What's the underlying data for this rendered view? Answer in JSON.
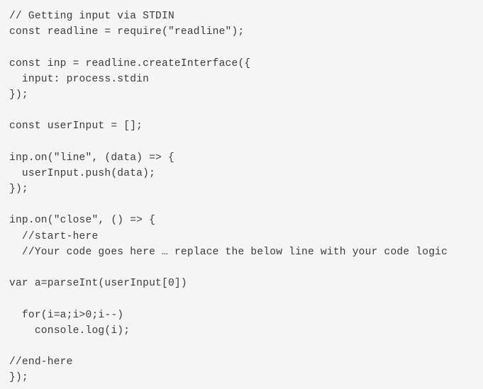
{
  "code_editor": {
    "lines": [
      "// Getting input via STDIN",
      "const readline = require(\"readline\");",
      "",
      "const inp = readline.createInterface({",
      "  input: process.stdin",
      "});",
      "",
      "const userInput = [];",
      "",
      "inp.on(\"line\", (data) => {",
      "  userInput.push(data);",
      "});",
      "",
      "inp.on(\"close\", () => {",
      "  //start-here",
      "  //Your code goes here … replace the below line with your code logic",
      "",
      "var a=parseInt(userInput[0])",
      "",
      "  for(i=a;i>0;i--)",
      "    console.log(i);",
      "",
      "//end-here",
      "});"
    ]
  }
}
